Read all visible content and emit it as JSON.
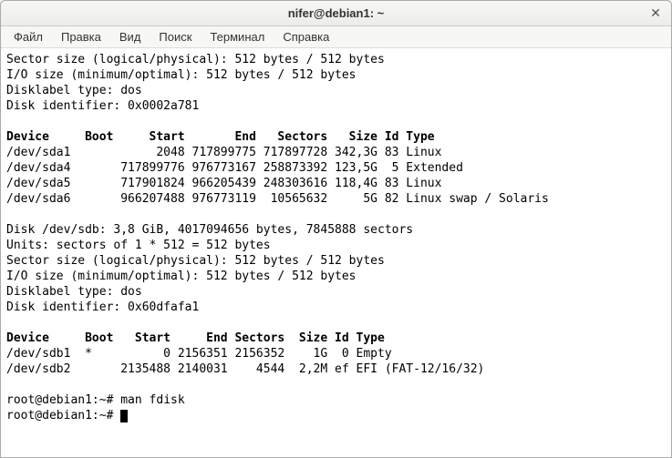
{
  "window": {
    "title": "nifer@debian1: ~"
  },
  "menu": {
    "file": "Файл",
    "edit": "Правка",
    "view": "Вид",
    "search": "Поиск",
    "terminal": "Терминал",
    "help": "Справка"
  },
  "term": {
    "l01": "Sector size (logical/physical): 512 bytes / 512 bytes",
    "l02": "I/O size (minimum/optimal): 512 bytes / 512 bytes",
    "l03": "Disklabel type: dos",
    "l04": "Disk identifier: 0x0002a781",
    "l05": "",
    "hdr1": "Device     Boot     Start       End   Sectors   Size Id Type",
    "l06": "/dev/sda1            2048 717899775 717897728 342,3G 83 Linux",
    "l07": "/dev/sda4       717899776 976773167 258873392 123,5G  5 Extended",
    "l08": "/dev/sda5       717901824 966205439 248303616 118,4G 83 Linux",
    "l09": "/dev/sda6       966207488 976773119  10565632     5G 82 Linux swap / Solaris",
    "l10": "",
    "l11": "Disk /dev/sdb: 3,8 GiB, 4017094656 bytes, 7845888 sectors",
    "l12": "Units: sectors of 1 * 512 = 512 bytes",
    "l13": "Sector size (logical/physical): 512 bytes / 512 bytes",
    "l14": "I/O size (minimum/optimal): 512 bytes / 512 bytes",
    "l15": "Disklabel type: dos",
    "l16": "Disk identifier: 0x60dfafa1",
    "l17": "",
    "hdr2": "Device     Boot   Start     End Sectors  Size Id Type",
    "l18": "/dev/sdb1  *          0 2156351 2156352    1G  0 Empty",
    "l19": "/dev/sdb2       2135488 2140031    4544  2,2M ef EFI (FAT-12/16/32)",
    "l20": "",
    "prompt1": "root@debian1:~# ",
    "cmd1": "man fdisk",
    "prompt2": "root@debian1:~# "
  }
}
